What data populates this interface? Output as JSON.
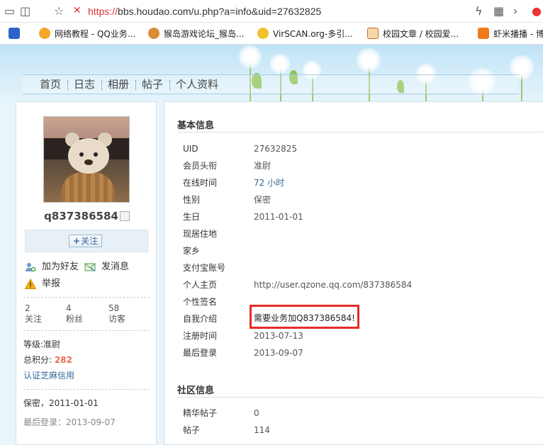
{
  "browser": {
    "url_scheme": "https://",
    "url_rest": "bbs.houdao.com/u.php?a=info&uid=27632825",
    "bookmarks": [
      {
        "label": "网络教程 - QQ业务..."
      },
      {
        "label": "猴岛游戏论坛_猴岛..."
      },
      {
        "label": "VirSCAN.org-多引..."
      },
      {
        "label": "校园文章 / 校园爱..."
      },
      {
        "label": "虾米播播 - 博"
      }
    ]
  },
  "nav": {
    "items": [
      {
        "label": "首页"
      },
      {
        "label": "日志"
      },
      {
        "label": "相册"
      },
      {
        "label": "帖子"
      },
      {
        "label": "个人资料"
      }
    ]
  },
  "profile": {
    "username": "q837386584",
    "follow_label": "关注",
    "add_friend": "加为好友",
    "send_message": "发消息",
    "report": "举报",
    "stats": [
      {
        "value": "2",
        "label": "关注"
      },
      {
        "value": "4",
        "label": "粉丝"
      },
      {
        "value": "58",
        "label": "访客"
      }
    ],
    "level_label": "等级:",
    "level_value": "准尉",
    "points_label": "总积分:",
    "points_value": "282",
    "verify_link": "认证芝麻信用",
    "birth_info": "保密，2011-01-01",
    "last_login": "最后登录：2013-09-07"
  },
  "basic_info": {
    "title": "基本信息",
    "rows": [
      {
        "label": "UID",
        "value": "27632825"
      },
      {
        "label": "会员头衔",
        "value": "准尉"
      },
      {
        "label": "在线时间",
        "value": "72 小时"
      },
      {
        "label": "性别",
        "value": "保密"
      },
      {
        "label": "生日",
        "value": "2011-01-01"
      },
      {
        "label": "现居住地",
        "value": ""
      },
      {
        "label": "家乡",
        "value": ""
      },
      {
        "label": "支付宝账号",
        "value": ""
      },
      {
        "label": "个人主页",
        "value": "http://user.qzone.qq.com/837386584"
      },
      {
        "label": "个性签名",
        "value": ""
      },
      {
        "label": "自我介绍",
        "value": "需要业务加Q837386584!"
      },
      {
        "label": "注册时间",
        "value": "2013-07-13"
      },
      {
        "label": "最后登录",
        "value": "2013-09-07"
      }
    ]
  },
  "community_info": {
    "title": "社区信息",
    "rows": [
      {
        "label": "精华帖子",
        "value": "0"
      },
      {
        "label": "帖子",
        "value": "114"
      }
    ]
  }
}
